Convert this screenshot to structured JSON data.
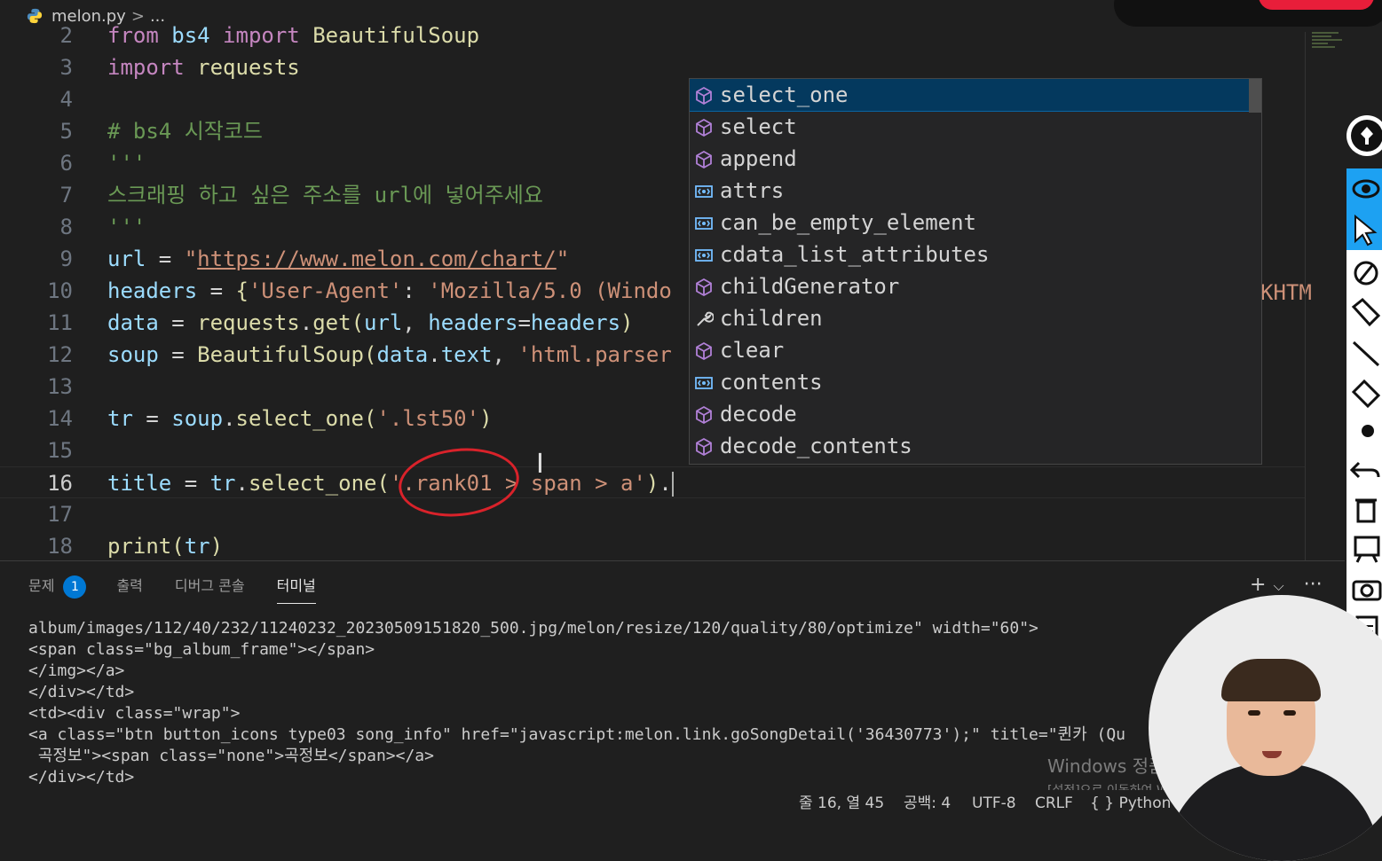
{
  "breadcrumb": {
    "file": "melon.py",
    "separator": ">",
    "more": "..."
  },
  "editor": {
    "lines": [
      {
        "num": "2",
        "tokens": [
          {
            "t": "from",
            "c": "kw"
          },
          {
            "t": " bs4 ",
            "c": "v"
          },
          {
            "t": "import",
            "c": "kw"
          },
          {
            "t": " BeautifulSoup",
            "c": "fn"
          }
        ]
      },
      {
        "num": "3",
        "tokens": [
          {
            "t": "import",
            "c": "kw"
          },
          {
            "t": " requests",
            "c": "fn"
          }
        ]
      },
      {
        "num": "4",
        "tokens": []
      },
      {
        "num": "5",
        "tokens": [
          {
            "t": "# bs4 시작코드",
            "c": "c"
          }
        ]
      },
      {
        "num": "6",
        "tokens": [
          {
            "t": "'''",
            "c": "c"
          }
        ]
      },
      {
        "num": "7",
        "tokens": [
          {
            "t": "스크래핑 하고 싶은 주소를 url에 넣어주세요",
            "c": "c"
          }
        ]
      },
      {
        "num": "8",
        "tokens": [
          {
            "t": "'''",
            "c": "c"
          }
        ]
      },
      {
        "num": "9",
        "tokens": [
          {
            "t": "url",
            "c": "v"
          },
          {
            "t": " = ",
            "c": "op"
          },
          {
            "t": "\"",
            "c": "s"
          },
          {
            "t": "https://www.melon.com/chart/",
            "c": "s u"
          },
          {
            "t": "\"",
            "c": "s"
          }
        ]
      },
      {
        "num": "10",
        "tokens": [
          {
            "t": "headers",
            "c": "v"
          },
          {
            "t": " = ",
            "c": "op"
          },
          {
            "t": "{",
            "c": "fn"
          },
          {
            "t": "'User-Agent'",
            "c": "s"
          },
          {
            "t": ": ",
            "c": "op"
          },
          {
            "t": "'Mozilla/5.0 (Windo",
            "c": "s"
          }
        ]
      },
      {
        "num": "11",
        "tokens": [
          {
            "t": "data",
            "c": "v"
          },
          {
            "t": " = ",
            "c": "op"
          },
          {
            "t": "requests",
            "c": "fn"
          },
          {
            "t": ".",
            "c": "op"
          },
          {
            "t": "get",
            "c": "fn"
          },
          {
            "t": "(",
            "c": "fn"
          },
          {
            "t": "url",
            "c": "v"
          },
          {
            "t": ", ",
            "c": "op"
          },
          {
            "t": "headers",
            "c": "v"
          },
          {
            "t": "=",
            "c": "op"
          },
          {
            "t": "headers",
            "c": "v"
          },
          {
            "t": ")",
            "c": "fn"
          }
        ]
      },
      {
        "num": "12",
        "tokens": [
          {
            "t": "soup",
            "c": "v"
          },
          {
            "t": " = ",
            "c": "op"
          },
          {
            "t": "BeautifulSoup",
            "c": "fn"
          },
          {
            "t": "(",
            "c": "fn"
          },
          {
            "t": "data",
            "c": "v"
          },
          {
            "t": ".",
            "c": "op"
          },
          {
            "t": "text",
            "c": "v"
          },
          {
            "t": ", ",
            "c": "op"
          },
          {
            "t": "'html.parser",
            "c": "s"
          }
        ]
      },
      {
        "num": "13",
        "tokens": []
      },
      {
        "num": "14",
        "tokens": [
          {
            "t": "tr",
            "c": "v"
          },
          {
            "t": " = ",
            "c": "op"
          },
          {
            "t": "soup",
            "c": "v"
          },
          {
            "t": ".",
            "c": "op"
          },
          {
            "t": "select_one",
            "c": "fn"
          },
          {
            "t": "(",
            "c": "fn"
          },
          {
            "t": "'.lst50'",
            "c": "s"
          },
          {
            "t": ")",
            "c": "fn"
          }
        ]
      },
      {
        "num": "15",
        "tokens": []
      },
      {
        "num": "16",
        "current": true,
        "tokens": [
          {
            "t": "title",
            "c": "v"
          },
          {
            "t": " = ",
            "c": "op"
          },
          {
            "t": "tr",
            "c": "v"
          },
          {
            "t": ".",
            "c": "op"
          },
          {
            "t": "select_one",
            "c": "fn"
          },
          {
            "t": "(",
            "c": "fn"
          },
          {
            "t": "'.rank01 > span > a'",
            "c": "s"
          },
          {
            "t": ")",
            "c": "fn"
          },
          {
            "t": ".",
            "c": "op"
          }
        ]
      },
      {
        "num": "17",
        "tokens": []
      },
      {
        "num": "18",
        "tokens": [
          {
            "t": "print",
            "c": "fn"
          },
          {
            "t": "(",
            "c": "fn"
          },
          {
            "t": "tr",
            "c": "v"
          },
          {
            "t": ")",
            "c": "fn"
          }
        ]
      }
    ],
    "overflow_text": "KHTM"
  },
  "suggestions": [
    {
      "label": "select_one",
      "icon": "method-icon",
      "selected": true
    },
    {
      "label": "select",
      "icon": "method-icon"
    },
    {
      "label": "append",
      "icon": "method-icon"
    },
    {
      "label": "attrs",
      "icon": "field-icon"
    },
    {
      "label": "can_be_empty_element",
      "icon": "field-icon"
    },
    {
      "label": "cdata_list_attributes",
      "icon": "field-icon"
    },
    {
      "label": "childGenerator",
      "icon": "method-icon"
    },
    {
      "label": "children",
      "icon": "property-wrench-icon"
    },
    {
      "label": "clear",
      "icon": "method-icon"
    },
    {
      "label": "contents",
      "icon": "field-icon"
    },
    {
      "label": "decode",
      "icon": "method-icon"
    },
    {
      "label": "decode_contents",
      "icon": "method-icon"
    }
  ],
  "panel": {
    "tabs": [
      {
        "label": "문제",
        "badge": "1"
      },
      {
        "label": "출력"
      },
      {
        "label": "디버그 콘솔"
      },
      {
        "label": "터미널",
        "active": true
      }
    ],
    "actions": {
      "add": "+",
      "dropdown": "⌵",
      "more": "···"
    },
    "terminal_lines": [
      "album/images/112/40/232/11240232_20230509151820_500.jpg/melon/resize/120/quality/80/optimize\" width=\"60\">",
      "<span class=\"bg_album_frame\"></span>",
      "</img></a>",
      "</div></td>",
      "<td><div class=\"wrap\">",
      "<a class=\"btn button_icons type03 song_info\" href=\"javascript:melon.link.goSongDetail('36430773');\" title=\"퀸카 (Qu",
      " 곡정보\"><span class=\"none\">곡정보</span></a>",
      "</div></td>"
    ]
  },
  "watermark": {
    "line1": "Windows 정품 인증",
    "line2": "[설정]으로 이동하여 Windows를 정품 인증합니다."
  },
  "status": {
    "position": "줄 16, 열 45",
    "spaces": "공백: 4",
    "encoding": "UTF-8",
    "eol": "CRLF",
    "language": "{ } Python"
  }
}
